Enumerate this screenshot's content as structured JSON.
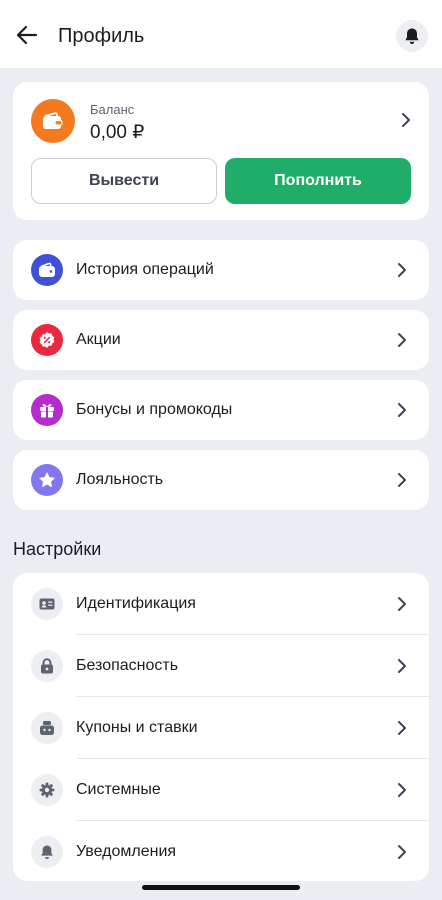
{
  "header": {
    "title": "Профиль",
    "back_icon": "arrow-left-icon",
    "bell_icon": "bell-icon"
  },
  "balance": {
    "label": "Баланс",
    "value": "0,00 ₽",
    "withdraw_label": "Вывести",
    "deposit_label": "Пополнить",
    "icon": "wallet-icon"
  },
  "menu": [
    {
      "label": "История операций",
      "icon": "wallet-icon",
      "color": "#3f51d8"
    },
    {
      "label": "Акции",
      "icon": "discount-badge-icon",
      "color": "#e8293f"
    },
    {
      "label": "Бонусы и промокоды",
      "icon": "gift-icon",
      "color": "#b42cc9"
    },
    {
      "label": "Лояльность",
      "icon": "star-icon",
      "color": "#8277f0"
    }
  ],
  "settings": {
    "title": "Настройки",
    "items": [
      {
        "label": "Идентификация",
        "icon": "id-card-icon"
      },
      {
        "label": "Безопасность",
        "icon": "lock-icon"
      },
      {
        "label": "Купоны и ставки",
        "icon": "coupon-icon"
      },
      {
        "label": "Системные",
        "icon": "gear-icon"
      },
      {
        "label": "Уведомления",
        "icon": "bell-icon"
      }
    ]
  },
  "colors": {
    "accent_green": "#20ad6a",
    "wallet_orange": "#f47a20",
    "background": "#eaedf2"
  }
}
